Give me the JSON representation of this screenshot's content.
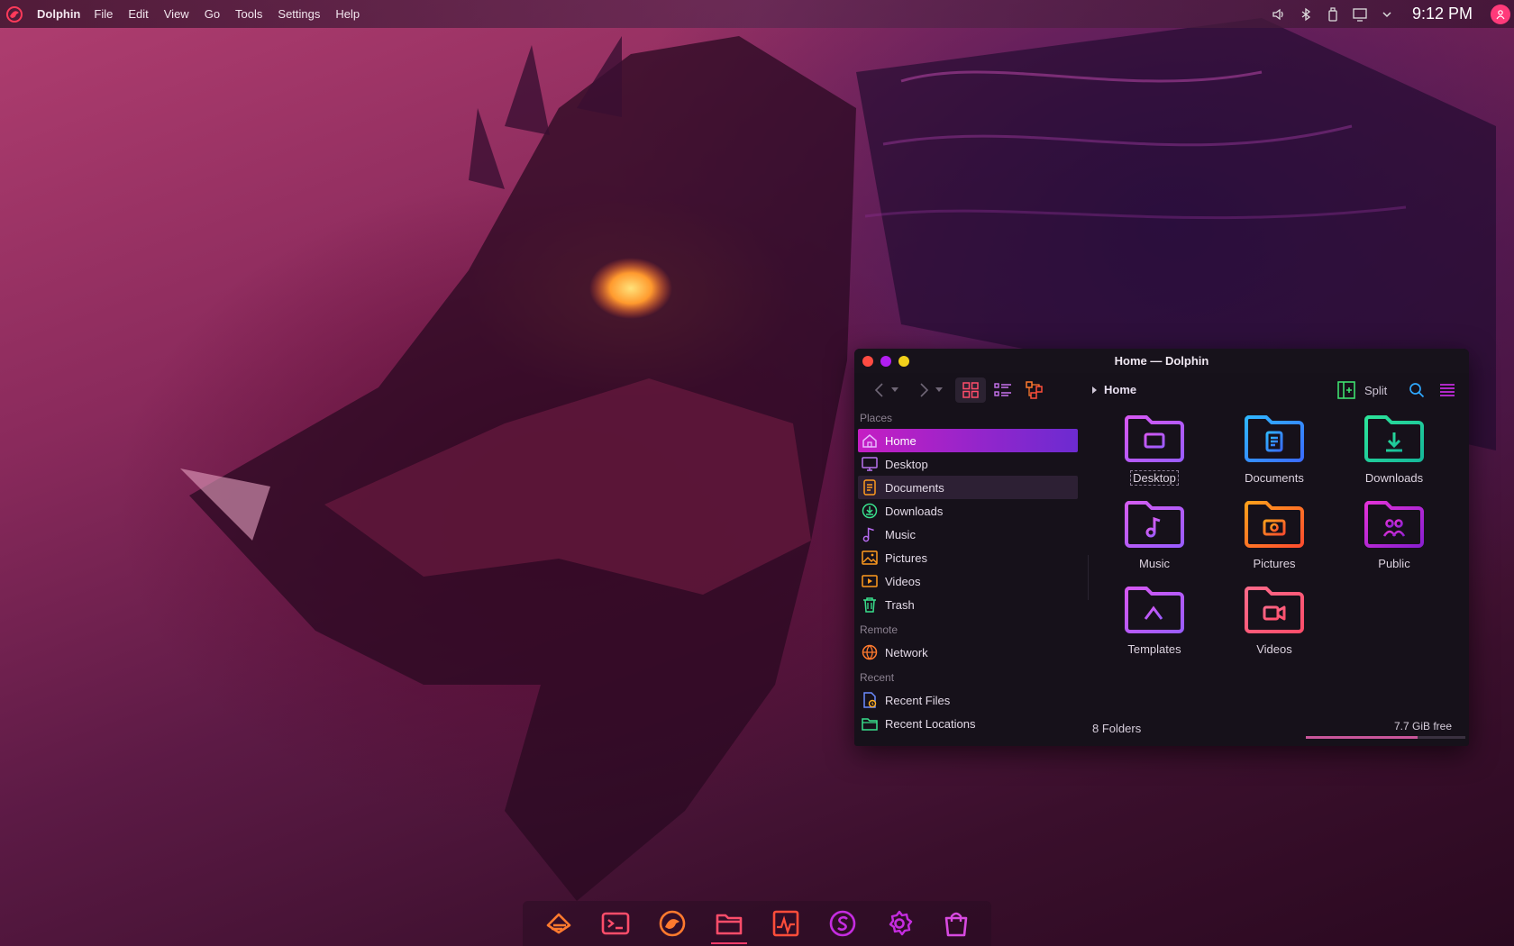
{
  "topbar": {
    "app_name": "Dolphin",
    "menu": [
      "File",
      "Edit",
      "View",
      "Go",
      "Tools",
      "Settings",
      "Help"
    ],
    "clock": "9:12 PM",
    "tray_icons": [
      "volume-icon",
      "bluetooth-icon",
      "usb-drive-icon",
      "display-icon",
      "chevron-down-icon",
      "user-avatar"
    ]
  },
  "window": {
    "title": "Home — Dolphin",
    "toolbar": {
      "breadcrumb": "Home",
      "split_label": "Split",
      "view_modes": [
        "icons-view",
        "details-view",
        "tree-view"
      ],
      "active_view": "icons-view"
    },
    "sidebar": {
      "sections": [
        {
          "label": "Places",
          "items": [
            {
              "label": "Home",
              "icon": "home-icon",
              "color": "#b86cf2"
            },
            {
              "label": "Desktop",
              "icon": "desktop-icon",
              "color": "#b873f0"
            },
            {
              "label": "Documents",
              "icon": "documents-icon",
              "color": "#ff9a1e"
            },
            {
              "label": "Downloads",
              "icon": "downloads-icon",
              "color": "#39e08c"
            },
            {
              "label": "Music",
              "icon": "music-icon",
              "color": "#b86cf2"
            },
            {
              "label": "Pictures",
              "icon": "pictures-icon",
              "color": "#ff9a1e"
            },
            {
              "label": "Videos",
              "icon": "videos-icon",
              "color": "#ff9a1e"
            },
            {
              "label": "Trash",
              "icon": "trash-icon",
              "color": "#39e08c"
            }
          ]
        },
        {
          "label": "Remote",
          "items": [
            {
              "label": "Network",
              "icon": "network-icon",
              "color": "#ff7a2e"
            }
          ]
        },
        {
          "label": "Recent",
          "items": [
            {
              "label": "Recent Files",
              "icon": "recent-files-icon",
              "color": "#6c8cff"
            },
            {
              "label": "Recent Locations",
              "icon": "recent-locations-icon",
              "color": "#39e08c"
            }
          ]
        }
      ],
      "active_item": "Home",
      "hover_item": "Documents"
    },
    "folders": [
      {
        "label": "Desktop",
        "icon": "desktop-folder-icon",
        "from": "#d658f2",
        "to": "#9a5cff",
        "focused": true
      },
      {
        "label": "Documents",
        "icon": "documents-folder-icon",
        "from": "#2fb6ff",
        "to": "#3a6cff"
      },
      {
        "label": "Downloads",
        "icon": "downloads-folder-icon",
        "from": "#2ce39a",
        "to": "#16b89a"
      },
      {
        "label": "Music",
        "icon": "music-folder-icon",
        "from": "#d45df0",
        "to": "#9a5cff"
      },
      {
        "label": "Pictures",
        "icon": "pictures-folder-icon",
        "from": "#ff9f1c",
        "to": "#ff4d2e"
      },
      {
        "label": "Public",
        "icon": "public-folder-icon",
        "from": "#e232d8",
        "to": "#8a1fd0"
      },
      {
        "label": "Templates",
        "icon": "templates-folder-icon",
        "from": "#d658f2",
        "to": "#9a5cff"
      },
      {
        "label": "Videos",
        "icon": "videos-folder-icon",
        "from": "#ff6a8a",
        "to": "#ff4d6a"
      }
    ],
    "status": {
      "folder_count": "8 Folders",
      "free_space": "7.7 GiB free",
      "used_fraction": 0.7
    }
  },
  "dock": {
    "items": [
      {
        "name": "shortcut-app-icon",
        "color": "#ff7a2e"
      },
      {
        "name": "terminal-icon",
        "color": "#ff4d6a"
      },
      {
        "name": "dragon-browser-icon",
        "color": "#ff7a2e"
      },
      {
        "name": "file-manager-icon",
        "color": "#ff4d6a",
        "running": true
      },
      {
        "name": "system-monitor-icon",
        "color": "#ff4d3a"
      },
      {
        "name": "s-app-icon",
        "color": "#c52ce0"
      },
      {
        "name": "settings-icon",
        "color": "#c52ce0"
      },
      {
        "name": "store-icon",
        "color": "#d84ae0"
      }
    ]
  }
}
